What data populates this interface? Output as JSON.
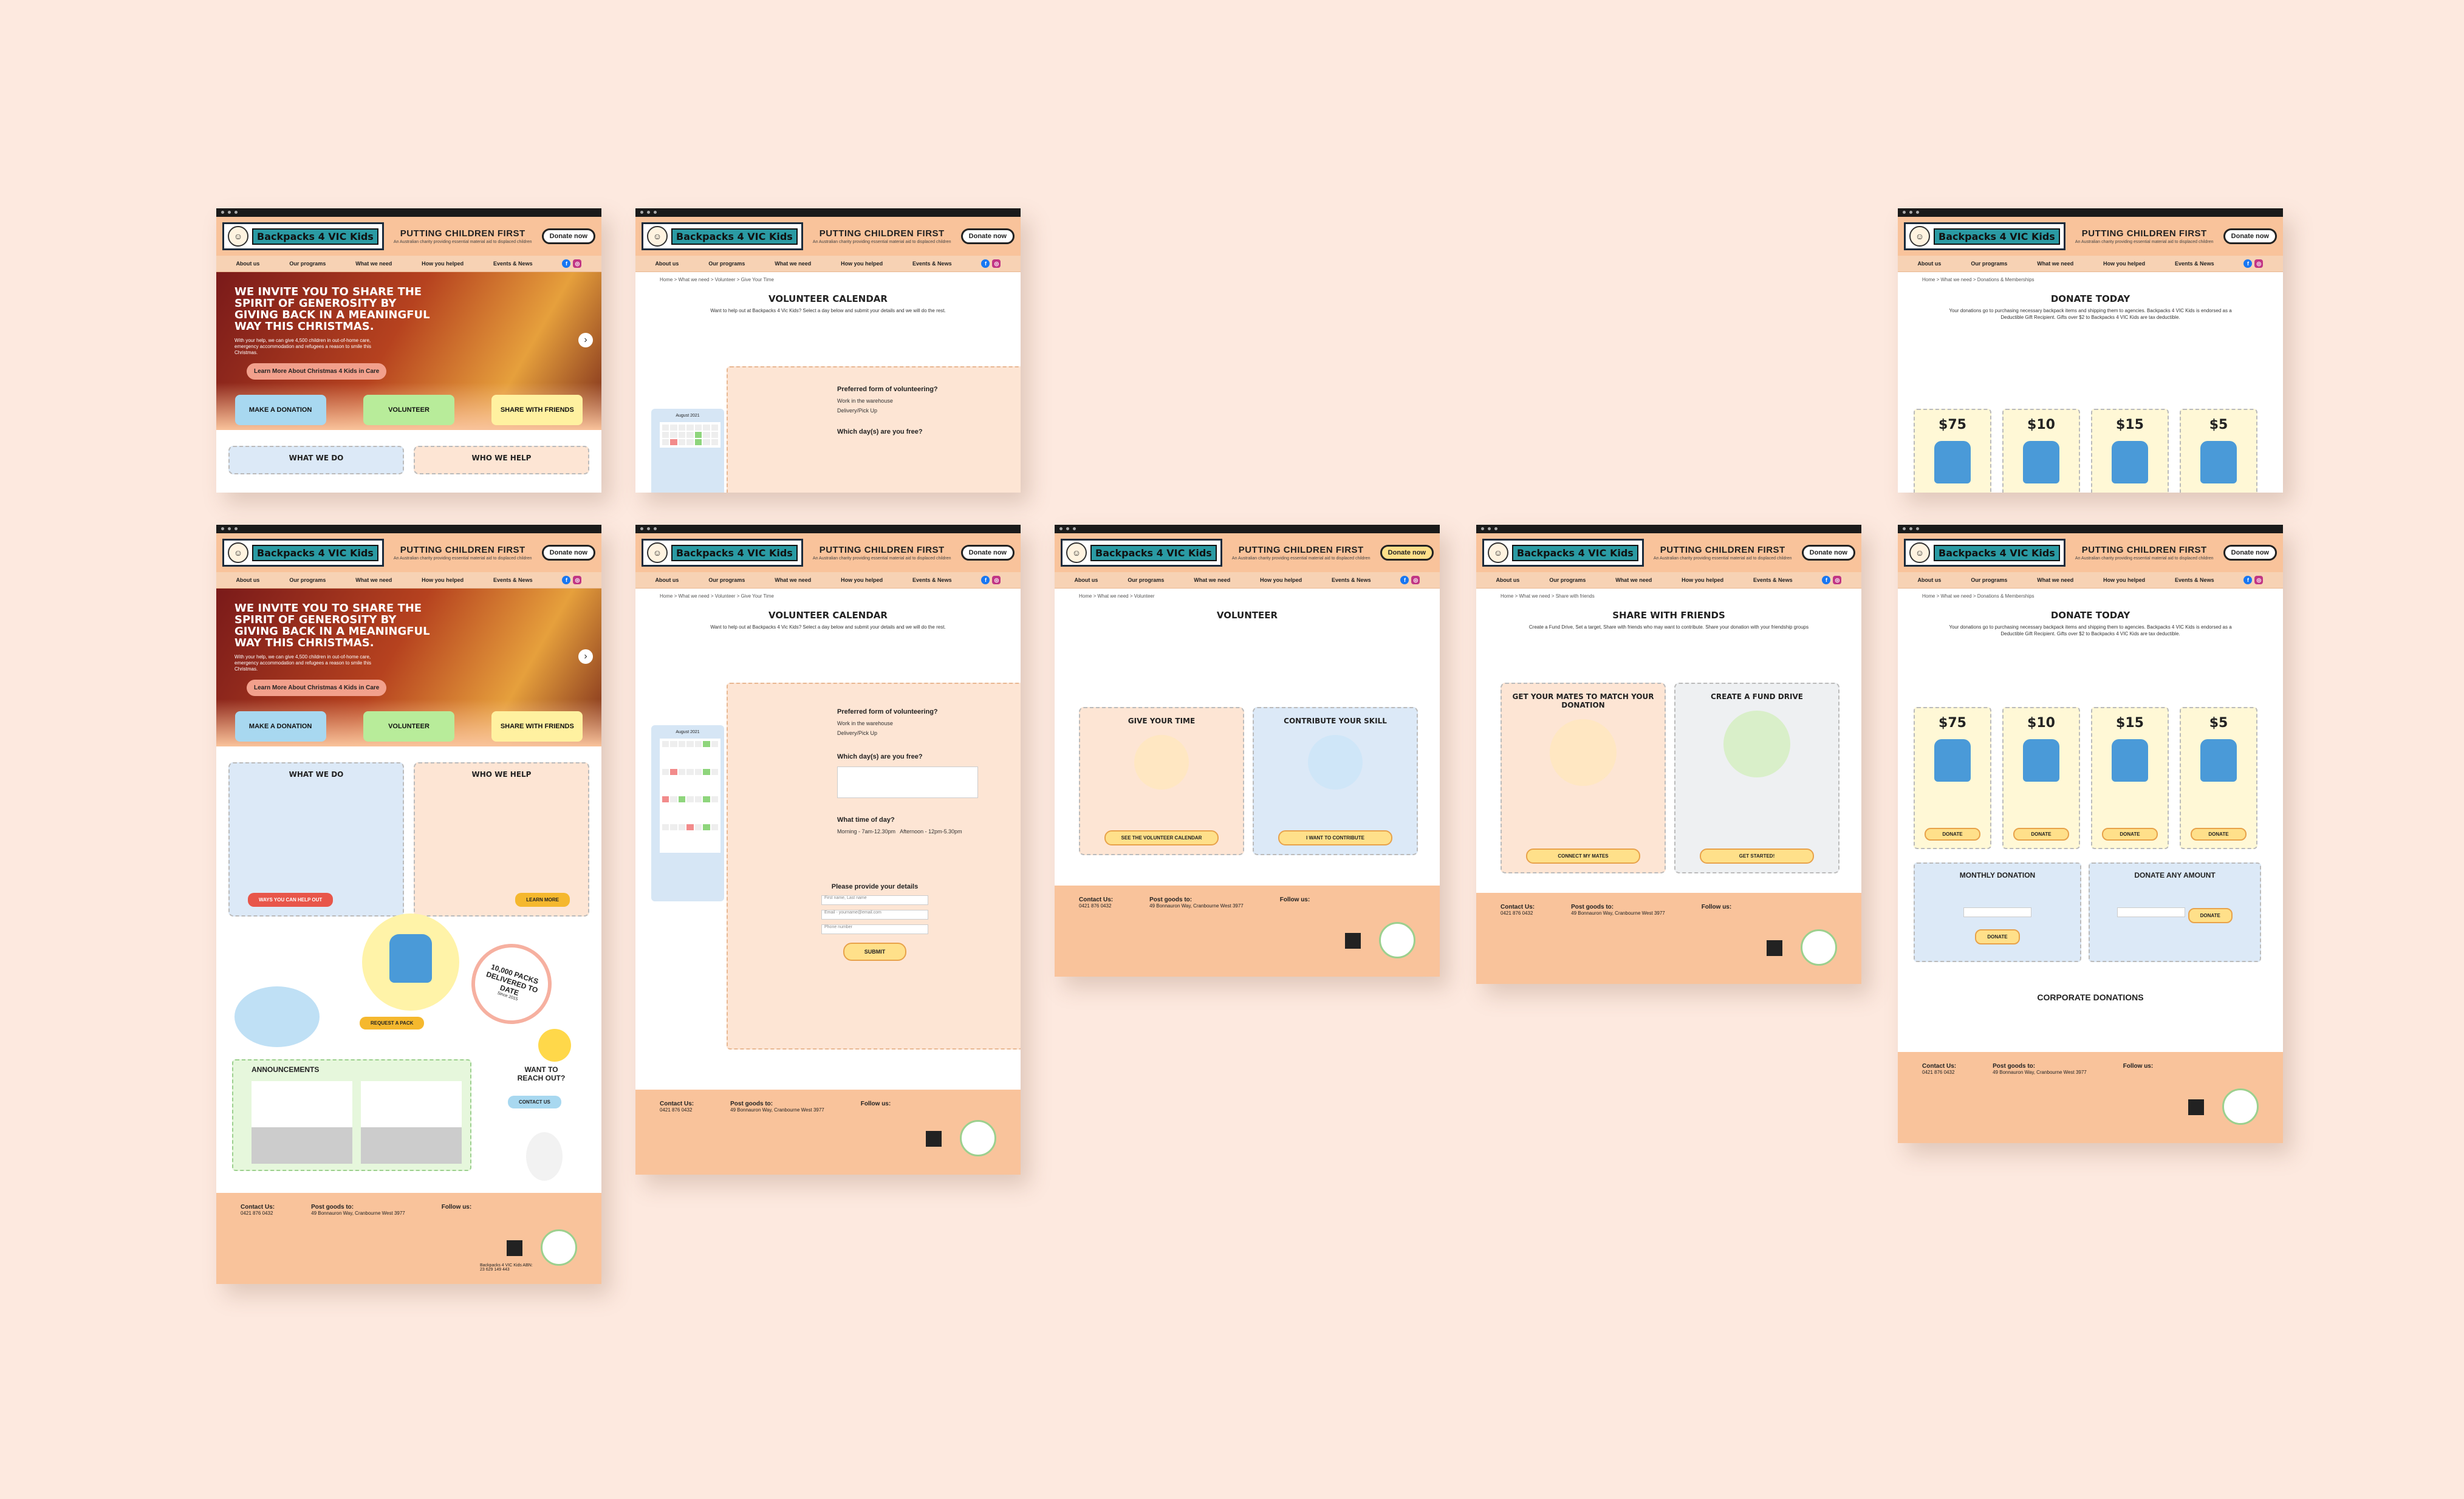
{
  "site": {
    "logo_text": "Backpacks 4 VIC Kids",
    "tagline": "PUTTING CHILDREN FIRST",
    "tagline_sub": "An Australian charity providing essential material aid to displaced children",
    "donate_label": "Donate now",
    "nav": [
      "About us",
      "Our programs",
      "What we need",
      "How you helped",
      "Events & News"
    ]
  },
  "home": {
    "hero_title": "We invite you to share the spirit of generosity by giving back in a meaningful way this Christmas.",
    "hero_text": "With your help, we can give 4,500 children in out-of-home care, emergency accommodation and refugees a reason to smile this Christmas.",
    "hero_cta": "Learn More About Christmas 4 Kids in Care",
    "btn_donation": "MAKE A DONATION",
    "btn_volunteer": "VOLUNTEER",
    "btn_share": "SHARE WITH FRIENDS",
    "what_we_do": "WHAT WE DO",
    "who_we_help": "WHO WE HELP",
    "ways_help": "WAYS YOU CAN HELP OUT",
    "learn_more": "LEARN MORE",
    "packs": "10,000 PACKS DELIVERED TO DATE",
    "since": "Since 2015",
    "request": "REQUEST A PACK",
    "announcements": "ANNOUNCEMENTS",
    "reach_out": "WANT TO REACH OUT?",
    "contact_us": "CONTACT US"
  },
  "volunteer_calendar": {
    "crumb": "Home > What we need > Volunteer > Give Your Time",
    "title": "VOLUNTEER CALENDAR",
    "intro": "Want to help out at Backpacks 4 Vic Kids? Select a day below and submit your details and we will do the rest.",
    "month": "August 2021",
    "q_form": "Preferred form of volunteering?",
    "opt_warehouse": "Work in the warehouse",
    "opt_delivery": "Delivery/Pick Up",
    "q_days": "Which day(s) are you free?",
    "q_time": "What time of day?",
    "opt_morning": "Morning - 7am-12.30pm",
    "opt_afternoon": "Afternoon - 12pm-5.30pm",
    "details": "Please provide your details",
    "f_name": "First name, Last name",
    "f_email": "Email - yourname@email.com",
    "f_phone": "Phone number",
    "submit": "SUBMIT"
  },
  "volunteer": {
    "crumb": "Home > What we need > Volunteer",
    "title": "VOLUNTEER",
    "give_time": "GIVE YOUR TIME",
    "contribute": "CONTRIBUTE YOUR SKILL",
    "see_calendar": "SEE THE VOLUNTEER CALENDAR",
    "i_want": "I WANT TO CONTRIBUTE"
  },
  "share": {
    "crumb": "Home > What we need > Share with friends",
    "title": "SHARE WITH FRIENDS",
    "intro": "Create a Fund Drive, Set a target, Share with friends who may want to contribute. Share your donation with your friendship groups",
    "mates": "GET YOUR MATES TO MATCH YOUR DONATION",
    "fund": "CREATE A FUND DRIVE",
    "connect": "CONNECT MY MATES",
    "started": "GET STARTED!"
  },
  "donate": {
    "crumb": "Home > What we need > Donations & Memberships",
    "title": "DONATE TODAY",
    "intro": "Your donations go to purchasing necessary backpack items and shipping them to agencies. Backpacks 4 VIC Kids is endorsed as a Deductible Gift Recipient. Gifts over $2 to Backpacks 4 VIC Kids are tax deductible.",
    "tiers": [
      "$75",
      "$10",
      "$15",
      "$5"
    ],
    "donate_btn": "DONATE",
    "monthly": "MONTHLY DONATION",
    "any": "DONATE ANY AMOUNT",
    "corporate": "CORPORATE DONATIONS"
  },
  "footer": {
    "contact": "Contact Us:",
    "post": "Post goods to:",
    "follow": "Follow us:",
    "phone": "0421 876 0432",
    "address": "49 Bonnauron Way, Cranbourne West 3977",
    "abn": "Backpacks 4 VIC Kids ABN: 23 629 149 443"
  },
  "colors": {
    "background": "#fde9df",
    "header": "#f9c39b",
    "accent_yellow": "#ffe08a",
    "blue": "#a8d8f0",
    "green": "#b8ec9a"
  }
}
